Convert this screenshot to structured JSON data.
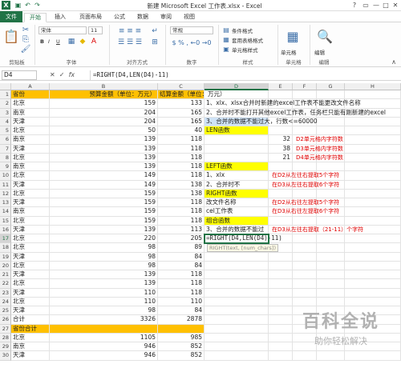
{
  "titlebar": {
    "app_icon": "X",
    "title": "新建 Microsoft Excel 工作表.xlsx - Excel",
    "controls": [
      "?",
      "▭",
      "—",
      "□",
      "✕"
    ]
  },
  "ribbon_tabs": [
    "文件",
    "开始",
    "插入",
    "页面布局",
    "公式",
    "数据",
    "审阅",
    "视图"
  ],
  "ribbon": {
    "groups": [
      "剪贴板",
      "字体",
      "对齐方式",
      "数字",
      "样式",
      "单元格",
      "编辑"
    ],
    "font_name": "宋体",
    "font_size": "11",
    "number_format": "常规",
    "styles": [
      "条件格式",
      "套用表格格式",
      "单元格样式"
    ],
    "cells_label": "单元格",
    "edit_label": "编辑"
  },
  "formula_bar": {
    "name_box": "D4",
    "formula": "=RIGHT(D4,LEN(D4)-11)",
    "icons": [
      "✕",
      "✓",
      "fx"
    ]
  },
  "columns": [
    "A",
    "B",
    "C",
    "D",
    "E",
    "F",
    "G",
    "H"
  ],
  "rows": [
    {
      "n": "1",
      "a": "省份",
      "b": "预算金额（单位：万元）",
      "c": "结算金额（单位：万元）",
      "d": "",
      "e": ""
    },
    {
      "n": "2",
      "a": "北京",
      "b": "159",
      "c": "133",
      "d": "1、xlx、xlsx合并时新建的excel工作表不能更改文件名称",
      "e": ""
    },
    {
      "n": "3",
      "a": "南京",
      "b": "204",
      "c": "165",
      "d": "2、合并时不能打开其他excel工作表，任务栏只能有刚新建的excel",
      "e": ""
    },
    {
      "n": "4",
      "a": "天津",
      "b": "204",
      "c": "165",
      "d": "3、合并的数据不能过大，行数<=60000",
      "e": ""
    },
    {
      "n": "5",
      "a": "北京",
      "b": "50",
      "c": "40",
      "d": "LEN函数",
      "e": ""
    },
    {
      "n": "6",
      "a": "南京",
      "b": "139",
      "c": "118",
      "d": "",
      "e": "32"
    },
    {
      "n": "7",
      "a": "天津",
      "b": "139",
      "c": "118",
      "d": "",
      "e": "38"
    },
    {
      "n": "8",
      "a": "北京",
      "b": "139",
      "c": "118",
      "d": "",
      "e": "21"
    },
    {
      "n": "9",
      "a": "南京",
      "b": "139",
      "c": "118",
      "d": "LEFT函数",
      "e": ""
    },
    {
      "n": "10",
      "a": "北京",
      "b": "149",
      "c": "118",
      "d": "1、xlx",
      "e": ""
    },
    {
      "n": "11",
      "a": "天津",
      "b": "149",
      "c": "138",
      "d": "2、合并时不",
      "e": ""
    },
    {
      "n": "12",
      "a": "北京",
      "b": "159",
      "c": "138",
      "d": "RIGHT函数",
      "e": ""
    },
    {
      "n": "13",
      "a": "天津",
      "b": "159",
      "c": "118",
      "d": "改文件名称",
      "e": ""
    },
    {
      "n": "14",
      "a": "南京",
      "b": "159",
      "c": "118",
      "d": "cel工作表",
      "e": ""
    },
    {
      "n": "15",
      "a": "北京",
      "b": "159",
      "c": "118",
      "d": "组合函数",
      "e": ""
    },
    {
      "n": "16",
      "a": "天津",
      "b": "139",
      "c": "113",
      "d": "3、合并的数据不能过",
      "e": ""
    },
    {
      "n": "17",
      "a": "北京",
      "b": "220",
      "c": "205",
      "d": "=RIGHT(D4,LEN(D4)-11)",
      "e": ""
    },
    {
      "n": "18",
      "a": "北京",
      "b": "98",
      "c": "89",
      "d": "",
      "e": ""
    },
    {
      "n": "19",
      "a": "天津",
      "b": "98",
      "c": "84",
      "d": "",
      "e": ""
    },
    {
      "n": "20",
      "a": "北京",
      "b": "98",
      "c": "84",
      "d": "",
      "e": ""
    },
    {
      "n": "21",
      "a": "天津",
      "b": "139",
      "c": "118",
      "d": "",
      "e": ""
    },
    {
      "n": "22",
      "a": "北京",
      "b": "139",
      "c": "118",
      "d": "",
      "e": ""
    },
    {
      "n": "23",
      "a": "天津",
      "b": "110",
      "c": "118",
      "d": "",
      "e": ""
    },
    {
      "n": "24",
      "a": "北京",
      "b": "110",
      "c": "110",
      "d": "",
      "e": ""
    },
    {
      "n": "25",
      "a": "天津",
      "b": "98",
      "c": "84",
      "d": "",
      "e": ""
    },
    {
      "n": "26",
      "a": "合计",
      "b": "3326",
      "c": "2878",
      "d": "",
      "e": ""
    },
    {
      "n": "27",
      "a": "省份合计",
      "b": "",
      "c": "",
      "d": "",
      "e": ""
    },
    {
      "n": "28",
      "a": "北京",
      "b": "1105",
      "c": "985",
      "d": "",
      "e": ""
    },
    {
      "n": "29",
      "a": "南京",
      "b": "946",
      "c": "852",
      "d": "",
      "e": ""
    },
    {
      "n": "30",
      "a": "天津",
      "b": "946",
      "c": "852",
      "d": "",
      "e": ""
    }
  ],
  "notes": {
    "r6": "D2单元格内字符数",
    "r7": "D3单元格内字符数",
    "r8": "D4单元格内字符数",
    "r10": "在D2从左往右提取5个字符",
    "r11": "在D3从左往右提取6个字符",
    "r13": "在D2从右往左提取5个字符",
    "r14": "在D3从右往左提取6个字符",
    "r16": "在D3从左往右提取（21-11）个字符"
  },
  "arg_tooltip": "RIGHT(text, [num_chars])",
  "watermark": {
    "big": "百科全说",
    "small": "助你轻松解决"
  },
  "colors": {
    "excel_green": "#217346",
    "yellow": "#ffff00",
    "orange": "#ffc000",
    "note_red": "#e00000"
  }
}
